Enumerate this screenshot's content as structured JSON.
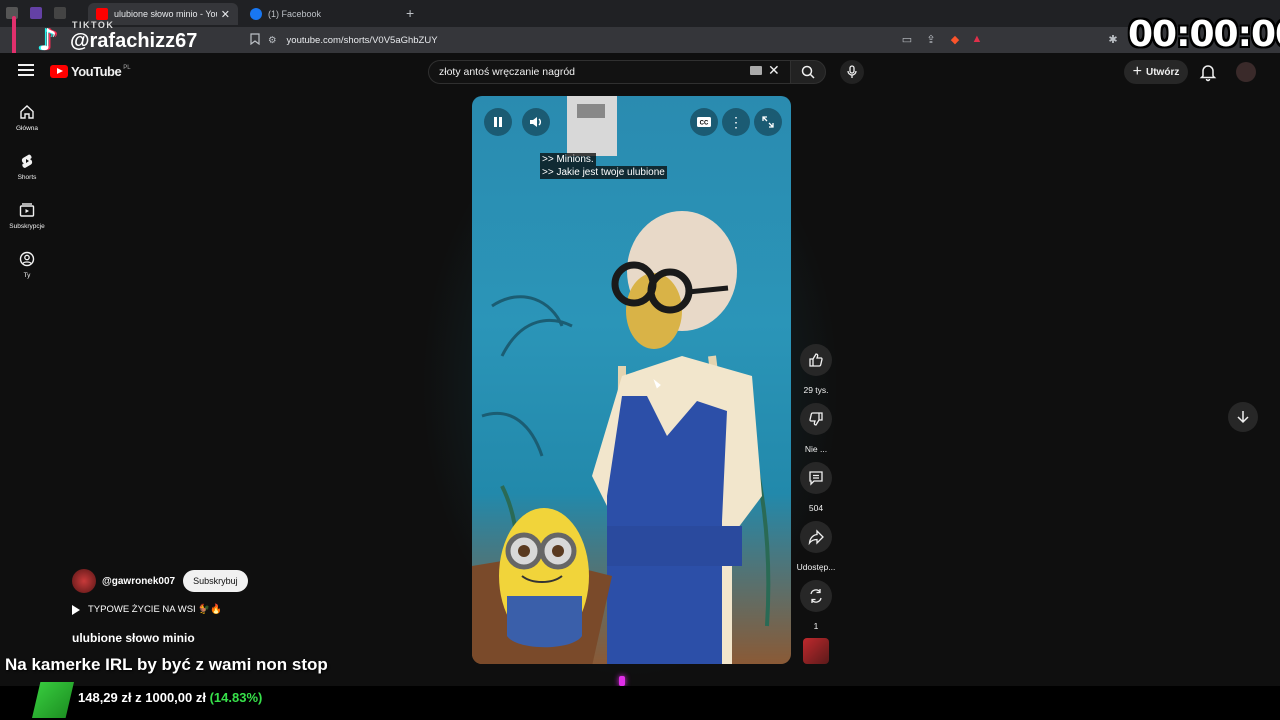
{
  "browser": {
    "tabs": [
      {
        "label": "ulubione słowo minio - YouT"
      },
      {
        "label": "(1) Facebook"
      }
    ],
    "new_tab": "+",
    "url": "youtube.com/shorts/V0V5aGhbZUY"
  },
  "tiktok": {
    "label": "TIKTOK",
    "username": "@rafachizz67"
  },
  "timer": "00:00:00",
  "youtube": {
    "logo_text": "YouTube",
    "logo_country": "PL",
    "search": {
      "value": "złoty antoś wręczanie nagród"
    },
    "create_label": "Utwórz"
  },
  "sidebar": {
    "items": [
      {
        "label": "Główna",
        "icon": "home-icon"
      },
      {
        "label": "Shorts",
        "icon": "shorts-icon"
      },
      {
        "label": "Subskrypcje",
        "icon": "subscriptions-icon"
      },
      {
        "label": "Ty",
        "icon": "you-icon"
      }
    ]
  },
  "video": {
    "captions": [
      ">> Minions.",
      ">> Jakie jest twoje ulubione"
    ],
    "progress_percent": 46
  },
  "actions": [
    {
      "label": "29 tys.",
      "icon": "like-icon"
    },
    {
      "label": "Nie ...",
      "icon": "dislike-icon"
    },
    {
      "label": "504",
      "icon": "comment-icon"
    },
    {
      "label": "Udostęp...",
      "icon": "share-icon"
    },
    {
      "label": "1",
      "icon": "remix-icon"
    }
  ],
  "channel": {
    "name": "@gawronek007",
    "subscribe_label": "Subskrybuj"
  },
  "playlist": {
    "label": "TYPOWE ŻYCIE NA WSI 🐓🔥"
  },
  "title": "ulubione słowo minio",
  "overlay_text": "Na kamerke IRL by być z wami non stop",
  "donation": {
    "amount": "148,29 zł",
    "connector": "z",
    "goal": "1000,00 zł",
    "percent": "(14.83%)"
  }
}
